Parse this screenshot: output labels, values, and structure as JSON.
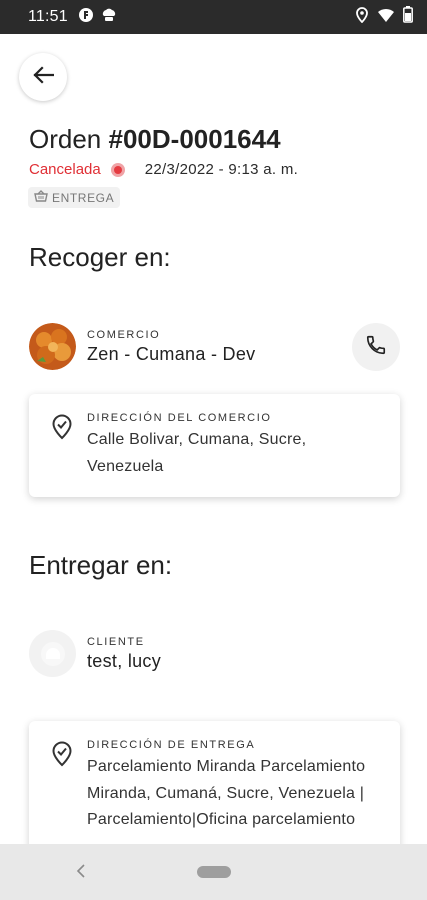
{
  "status_bar": {
    "time": "11:51"
  },
  "header": {
    "back_icon": "arrow-left-icon"
  },
  "order": {
    "title_prefix": "Orden",
    "number": "#00D-0001644",
    "status": "Cancelada",
    "status_color": "#e02f35",
    "date": "22/3/2022 - 9:13 a. m.",
    "type_badge": "ENTREGA",
    "type_icon": "basket-icon"
  },
  "pickup": {
    "heading": "Recoger en:",
    "party_label": "COMERCIO",
    "party_name": "Zen - Cumana - Dev",
    "call_icon": "phone-icon",
    "address_label": "DIRECCIÓN DEL COMERCIO",
    "address_lines": [
      "Calle Bolivar, Cumana, Sucre,",
      "Venezuela"
    ]
  },
  "delivery": {
    "heading": "Entregar en:",
    "party_label": "CLIENTE",
    "party_name": "test, lucy",
    "address_label": "DIRECCIÓN DE ENTREGA",
    "address_lines": [
      "Parcelamiento Miranda Parcelamiento",
      "Miranda, Cumaná, Sucre, Venezuela |",
      "Parcelamiento|Oficina parcelamiento"
    ]
  }
}
